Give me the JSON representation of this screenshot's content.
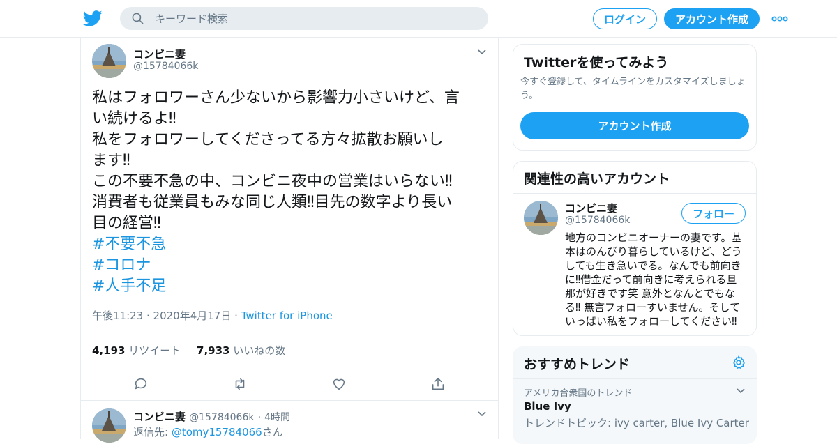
{
  "header": {
    "search_placeholder": "キーワード検索",
    "login_label": "ログイン",
    "signup_label": "アカウント作成"
  },
  "tweet": {
    "author_name": "コンビニ妻",
    "author_handle": "@15784066k",
    "text_lines": [
      "私はフォロワーさん少ないから影響力小さいけど、言",
      "い続けるよ‼",
      "私をフォロワーしてくださってる方々拡散お願いし",
      "ます‼",
      "この不要不急の中、コンビニ夜中の営業はいらない‼",
      "消費者も従業員もみな同じ人類‼目先の数字より長い",
      "目の経営‼"
    ],
    "hashtags": [
      "#不要不急",
      "#コロナ",
      "#人手不足"
    ],
    "timestamp": "午後11:23 · 2020年4月17日",
    "separator": "·",
    "source": "Twitter for iPhone",
    "retweet_count": "4,193",
    "retweet_label": "リツイート",
    "like_count": "7,933",
    "like_label": "いいねの数"
  },
  "reply": {
    "author_name": "コンビニ妻",
    "author_handle": "@15784066k",
    "dot": "·",
    "time": "4時間",
    "reply_prefix": "返信先: ",
    "reply_to": "@tomy15784066",
    "reply_suffix": "さん"
  },
  "signup_card": {
    "title": "Twitterを使ってみよう",
    "description": "今すぐ登録して、タイムラインをカスタマイズしましょう。",
    "button_label": "アカウント作成"
  },
  "related_card": {
    "title": "関連性の高いアカウント",
    "account_name": "コンビニ妻",
    "account_handle": "@15784066k",
    "follow_label": "フォロー",
    "bio_lines": [
      "地方のコンビニオーナーの妻です。基",
      "本はのんびり暮らしているけど、どう",
      "しても生き急いでる。なんでも前向き",
      "に‼借金だって前向きに考えられる旦",
      "那が好きです笑 意外となんとでもな",
      "る‼ 無言フォローすいません。そして",
      "いっぱい私をフォローしてください‼"
    ]
  },
  "trends": {
    "title": "おすすめトレンド",
    "items": [
      {
        "context": "アメリカ合衆国のトレンド",
        "name": "Blue Ivy",
        "detail": "トレンドトピック: ivy carter, Blue Ivy Carter"
      }
    ]
  },
  "colors": {
    "accent": "#1da1f2",
    "link": "#1b95e0",
    "muted": "#657786",
    "border": "#e6ecf0"
  }
}
